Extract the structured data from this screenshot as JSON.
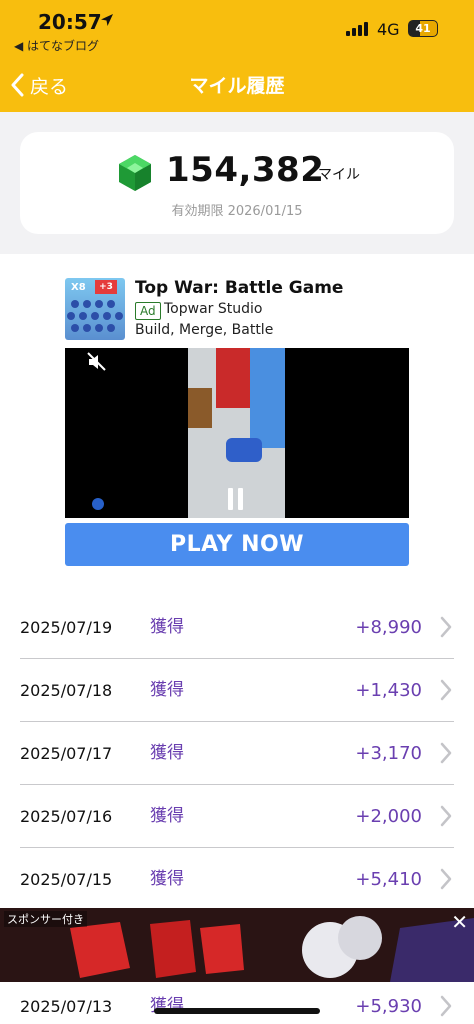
{
  "status": {
    "time": "20:57",
    "back_app": "◀ はてなブログ",
    "network": "4G",
    "battery": "41"
  },
  "nav": {
    "back_label": "戻る",
    "title": "マイル履歴"
  },
  "summary": {
    "miles": "154,382",
    "unit": "マイル",
    "expiry": "有効期限 2026/01/15",
    "accent": "#f8be0e",
    "gem_color": "#2db84a"
  },
  "ad": {
    "title": "Top War: Battle Game",
    "badge": "Ad",
    "studio": "Topwar Studio",
    "tagline": "Build, Merge, Battle",
    "cta": "PLAY NOW",
    "thumb_text": "X8",
    "thumb_text2": "+3"
  },
  "history": [
    {
      "date": "2025/07/19",
      "type": "獲得",
      "amount": "+8,990"
    },
    {
      "date": "2025/07/18",
      "type": "獲得",
      "amount": "+1,430"
    },
    {
      "date": "2025/07/17",
      "type": "獲得",
      "amount": "+3,170"
    },
    {
      "date": "2025/07/16",
      "type": "獲得",
      "amount": "+2,000"
    },
    {
      "date": "2025/07/15",
      "type": "獲得",
      "amount": "+5,410"
    },
    {
      "date": "2025/07/13",
      "type": "獲得",
      "amount": "+5,930"
    }
  ],
  "banner": {
    "label": "スポンサー付き",
    "close": "✕"
  }
}
